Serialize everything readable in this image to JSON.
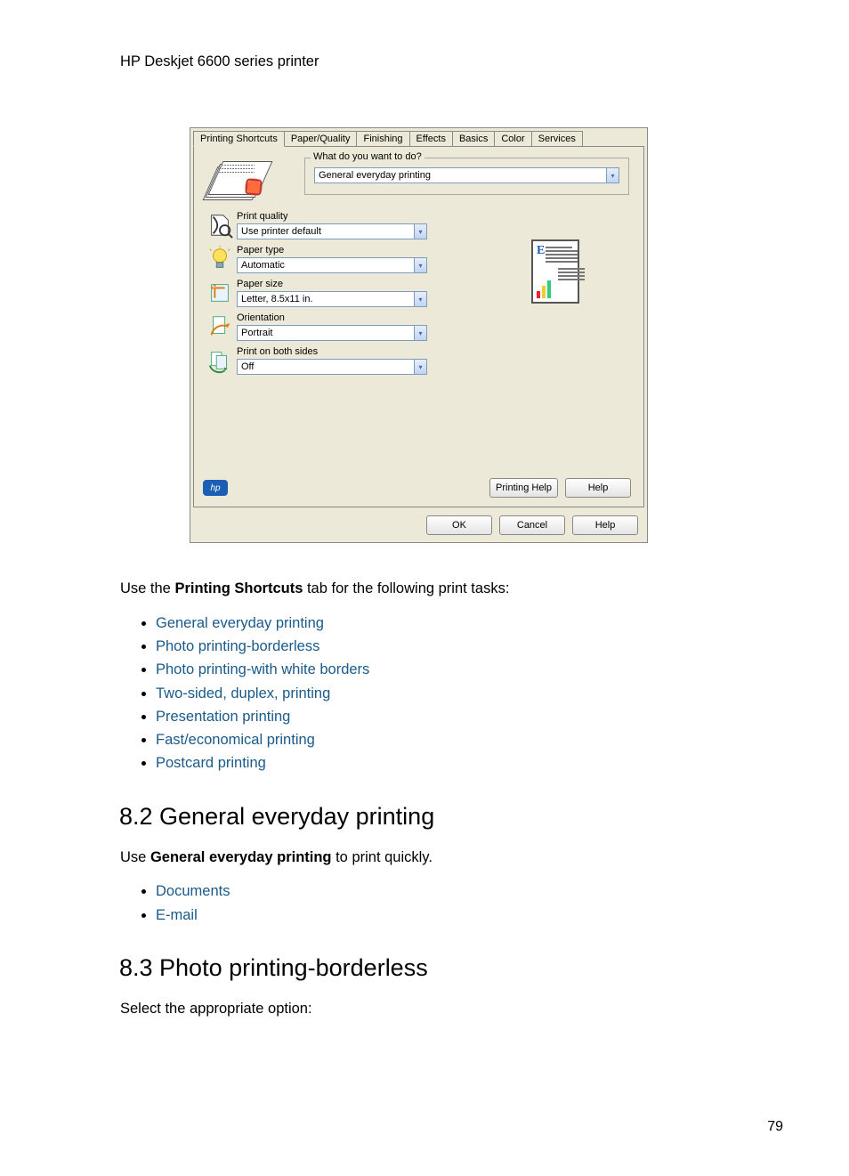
{
  "header": "HP Deskjet 6600 series printer",
  "dialog": {
    "tabs": [
      "Printing Shortcuts",
      "Paper/Quality",
      "Finishing",
      "Effects",
      "Basics",
      "Color",
      "Services"
    ],
    "active_tab_index": 0,
    "fieldset_legend": "What do you want to do?",
    "task_value": "General everyday printing",
    "options": {
      "print_quality": {
        "label": "Print quality",
        "value": "Use printer default"
      },
      "paper_type": {
        "label": "Paper type",
        "value": "Automatic"
      },
      "paper_size": {
        "label": "Paper size",
        "value": "Letter, 8.5x11 in."
      },
      "orientation": {
        "label": "Orientation",
        "value": "Portrait"
      },
      "both_sides": {
        "label": "Print on both sides",
        "value": "Off"
      }
    },
    "hp_badge": "hp",
    "buttons": {
      "printing_help": "Printing Help",
      "help_inner": "Help",
      "ok": "OK",
      "cancel": "Cancel",
      "help_outer": "Help"
    }
  },
  "doc": {
    "intro_pre": "Use the ",
    "intro_bold": "Printing Shortcuts",
    "intro_post": " tab for the following print tasks:",
    "tasks": [
      "General everyday printing",
      "Photo printing-borderless",
      "Photo printing-with white borders",
      "Two-sided, duplex, printing",
      "Presentation printing",
      "Fast/economical printing",
      "Postcard printing"
    ],
    "sec82_title": "8.2  General everyday printing",
    "sec82_pre": "Use ",
    "sec82_bold": "General everyday printing",
    "sec82_post": " to print quickly.",
    "sec82_items": [
      "Documents",
      "E-mail"
    ],
    "sec83_title": "8.3  Photo printing-borderless",
    "sec83_line": "Select the appropriate option:"
  },
  "page_number": "79"
}
